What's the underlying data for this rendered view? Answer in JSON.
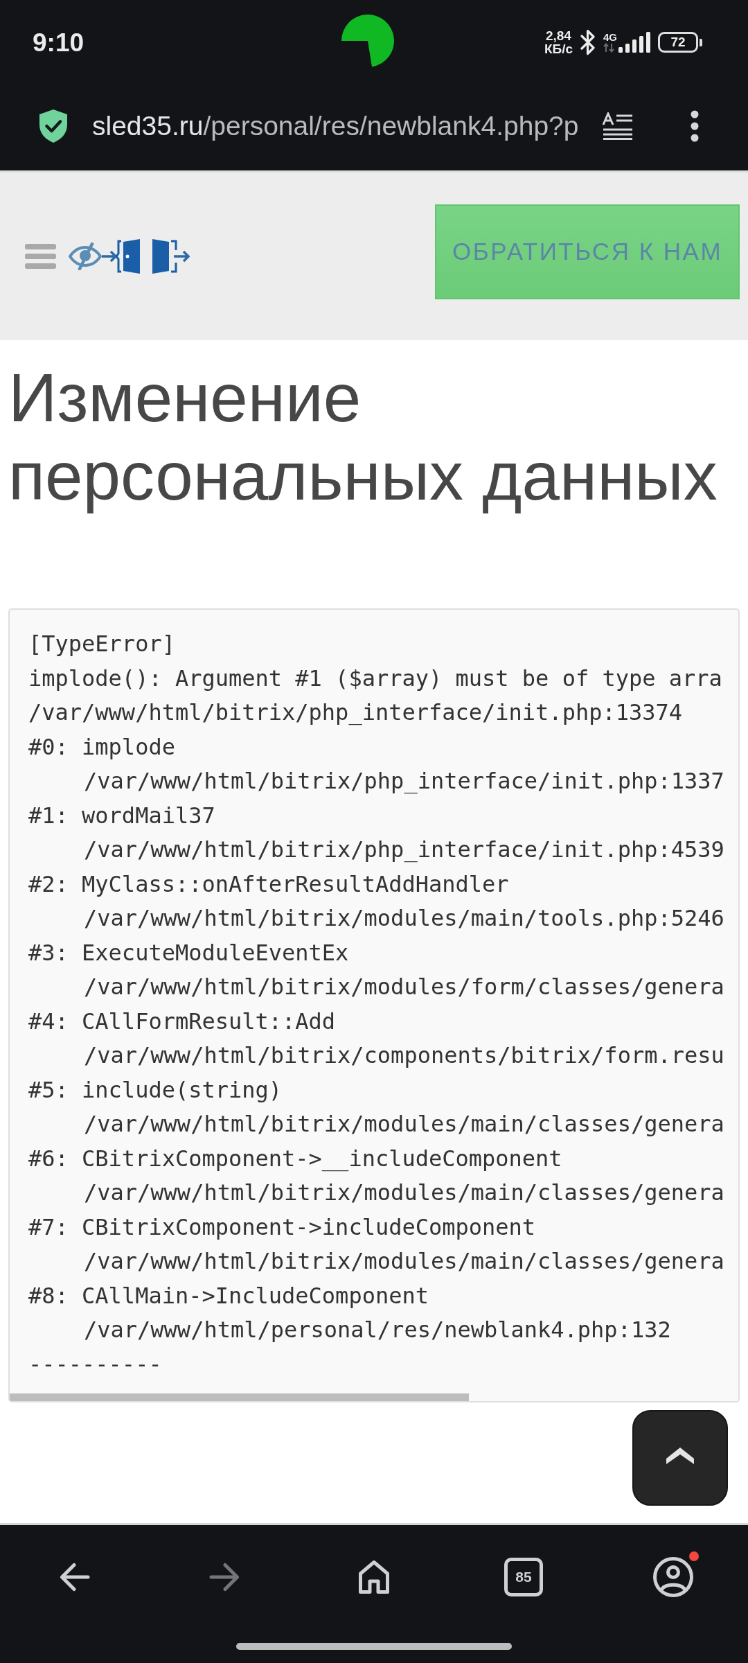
{
  "status_bar": {
    "time": "9:10",
    "net_speed": {
      "value": "2,84",
      "unit": "КБ/с"
    },
    "network": "4G",
    "battery": "72"
  },
  "address_bar": {
    "host": "sled35.ru",
    "path": "/personal/res/newblank4.php?p"
  },
  "site_header": {
    "contact_button": "ОБРАТИТЬСЯ К НАМ"
  },
  "page": {
    "title": "Изменение персональных данных"
  },
  "error_output": {
    "type": "[TypeError]",
    "message": "implode(): Argument #1 ($array) must be of type arra",
    "location": "/var/www/html/bitrix/php_interface/init.php:13374",
    "trace": [
      {
        "call": "#0: implode",
        "location": "/var/www/html/bitrix/php_interface/init.php:1337"
      },
      {
        "call": "#1: wordMail37",
        "location": "/var/www/html/bitrix/php_interface/init.php:4539"
      },
      {
        "call": "#2: MyClass::onAfterResultAddHandler",
        "location": "/var/www/html/bitrix/modules/main/tools.php:5246"
      },
      {
        "call": "#3: ExecuteModuleEventEx",
        "location": "/var/www/html/bitrix/modules/form/classes/genera"
      },
      {
        "call": "#4: CAllFormResult::Add",
        "location": "/var/www/html/bitrix/components/bitrix/form.resu"
      },
      {
        "call": "#5: include(string)",
        "location": "/var/www/html/bitrix/modules/main/classes/genera"
      },
      {
        "call": "#6: CBitrixComponent->__includeComponent",
        "location": "/var/www/html/bitrix/modules/main/classes/genera"
      },
      {
        "call": "#7: CBitrixComponent->includeComponent",
        "location": "/var/www/html/bitrix/modules/main/classes/genera"
      },
      {
        "call": "#8: CAllMain->IncludeComponent",
        "location": "/var/www/html/personal/res/newblank4.php:132"
      }
    ],
    "separator": "----------"
  },
  "browser_nav": {
    "items": [
      {
        "kind": "back",
        "disabled": false,
        "notification": false
      },
      {
        "kind": "forward",
        "disabled": true,
        "notification": false
      },
      {
        "kind": "home",
        "disabled": false,
        "notification": false
      },
      {
        "kind": "tabs",
        "count": "85",
        "disabled": false,
        "notification": false
      },
      {
        "kind": "profile",
        "disabled": false,
        "notification": true
      }
    ]
  }
}
